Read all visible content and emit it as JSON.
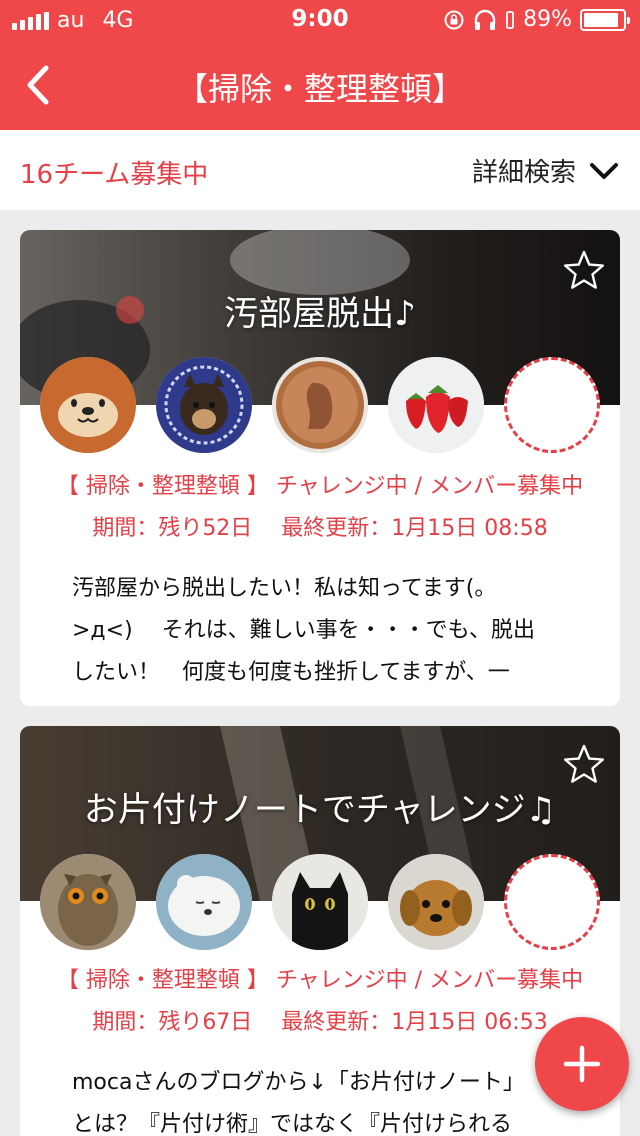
{
  "status_bar": {
    "carrier": "au",
    "network": "4G",
    "time": "9:00",
    "battery": "89%",
    "battery_level": 0.89
  },
  "nav": {
    "title": "【掃除・整理整頓】"
  },
  "filter": {
    "count_label": "16チーム募集中",
    "detail_label": "詳細検索"
  },
  "cards": [
    {
      "title": "汚部屋脱出♪",
      "category": "【 掃除・整理整頓 】",
      "status": "チャレンジ中 / メンバー募集中",
      "period": "期間：残り52日　 最終更新：1月15日 08:58",
      "description_lines": [
        "汚部屋から脱出したい！私は知ってます(。",
        ">д<)　 それは、難しい事を・・・でも、脱出",
        "したい！　何度も何度も挫折してますが、一"
      ],
      "avatars": [
        "otter-avatar",
        "shiba-dog-avatar",
        "penny-coin-avatar",
        "strawberries-avatar",
        "empty-slot"
      ]
    },
    {
      "title": "お片付けノートでチャレンジ♫",
      "category": "【 掃除・整理整頓 】",
      "status": "チャレンジ中 / メンバー募集中",
      "period": "期間：残り67日　 最終更新：1月15日 06:53",
      "description_lines": [
        "mocaさんのブログから↓「お片付けノート」",
        "とは？『片付け術』ではなく『片付けられる"
      ],
      "avatars": [
        "owl-avatar",
        "polar-bear-plush-avatar",
        "black-cat-avatar",
        "puppy-plush-avatar",
        "empty-slot"
      ]
    }
  ],
  "icons": {
    "back": "chevron-left-icon",
    "detail": "chevron-down-icon",
    "favorite": "star-outline-icon",
    "add": "plus-icon",
    "headphones": "headphones-icon",
    "rotation_lock": "rotation-lock-icon"
  },
  "colors": {
    "brand": "#f0484a",
    "accent_text": "#e53f47",
    "background": "#ececec"
  }
}
